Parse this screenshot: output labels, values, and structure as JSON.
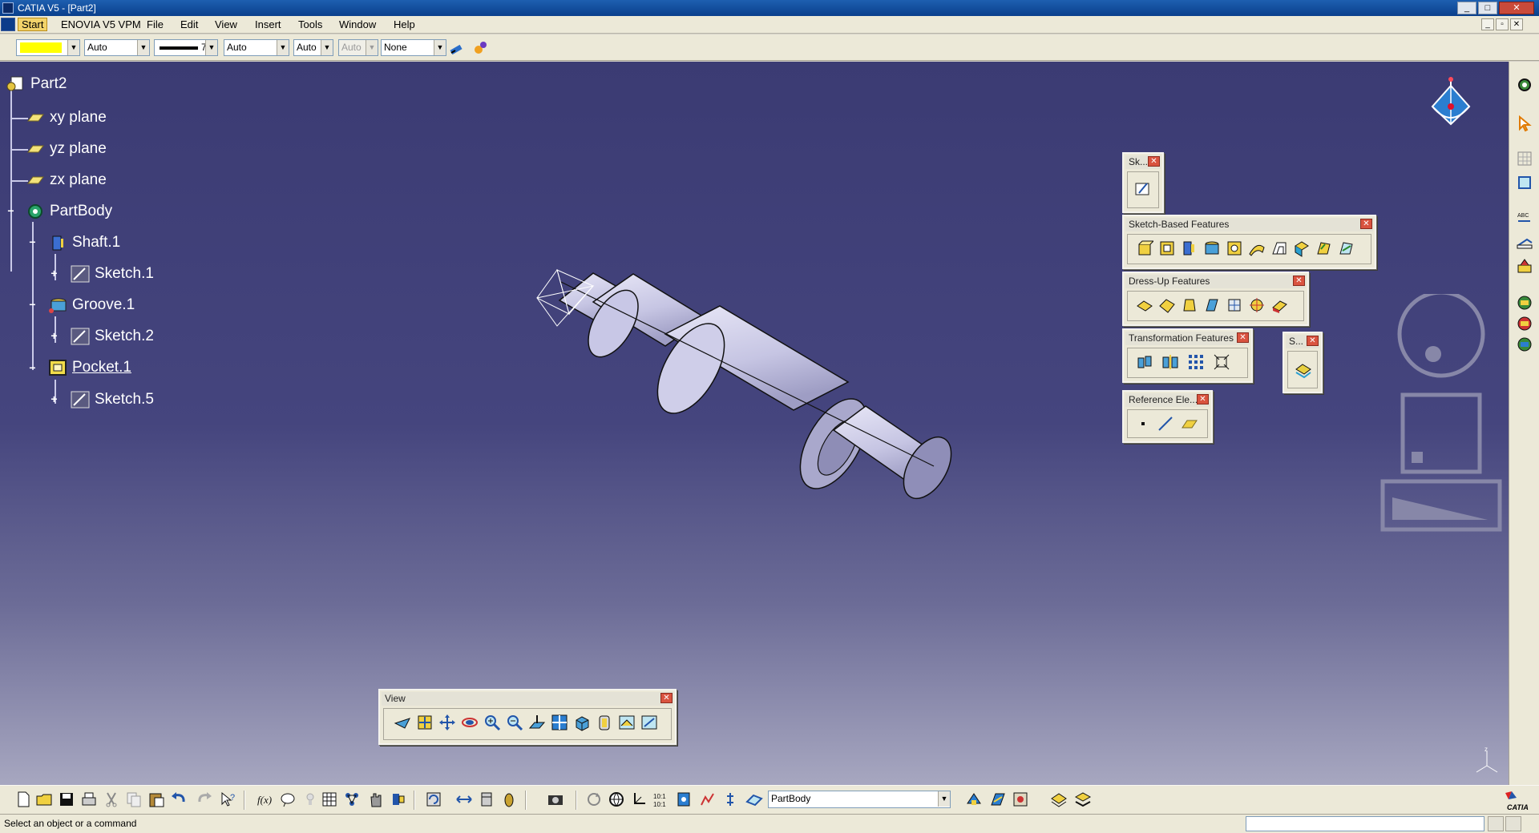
{
  "window": {
    "title": "CATIA V5 - [Part2]",
    "controls": [
      "_",
      "□",
      "✕"
    ],
    "mdi_controls": [
      "_",
      "▫",
      "✕"
    ]
  },
  "menu": {
    "start": "Start",
    "items": [
      "ENOVIA V5 VPM",
      "File",
      "Edit",
      "View",
      "Insert",
      "Tools",
      "Window",
      "Help"
    ]
  },
  "graphic_properties": {
    "fill_color": "#ffff00",
    "transparency": "Auto",
    "linetype_weight": "7",
    "line_type": "Auto",
    "point_type": "Auto",
    "layer_disabled": "Auto",
    "layer": "None"
  },
  "tree": {
    "root": "Part2",
    "items": [
      {
        "label": "xy plane"
      },
      {
        "label": "yz plane"
      },
      {
        "label": "zx plane"
      },
      {
        "label": "PartBody"
      },
      {
        "label": "Shaft.1"
      },
      {
        "label": "Sketch.1"
      },
      {
        "label": "Groove.1"
      },
      {
        "label": "Sketch.2"
      },
      {
        "label": "Pocket.1"
      },
      {
        "label": "Sketch.5"
      }
    ]
  },
  "toolbars": {
    "sketcher": "Sk...",
    "sketch_based": "Sketch-Based Features",
    "dress_up": "Dress-Up Features",
    "transformation": "Transformation Features",
    "surface": "S...",
    "reference": "Reference Ele...",
    "view": "View"
  },
  "compass_axes": {
    "z": "z",
    "x": "x",
    "y": "y"
  },
  "bottom": {
    "current_body": "PartBody",
    "status": "Select an object or a command",
    "brand": "CATIA"
  },
  "icons": {
    "title_app": "catia-app-icon",
    "compass": "compass-icon",
    "navigator": "navigation-circle-icon",
    "colors": {
      "workspace_top": "#3b3b73",
      "workspace_bottom": "#a7a7c0",
      "part_fill": "#c9c8e6"
    }
  }
}
